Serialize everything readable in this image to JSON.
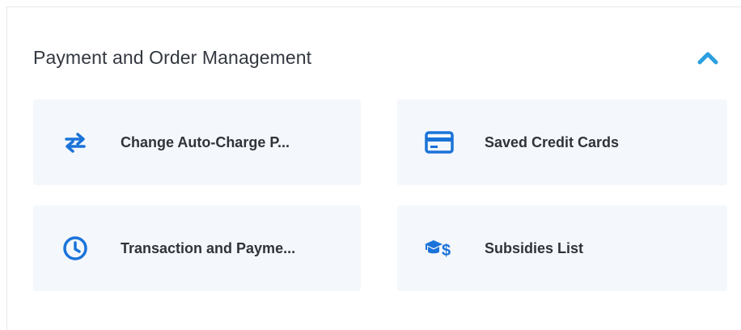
{
  "section": {
    "title": "Payment and Order Management"
  },
  "cards": [
    {
      "label": "Change Auto-Charge P...",
      "icon": "swap-arrows-icon"
    },
    {
      "label": "Saved Credit Cards",
      "icon": "credit-card-icon"
    },
    {
      "label": "Transaction and Payme...",
      "icon": "clock-icon"
    },
    {
      "label": "Subsidies List",
      "icon": "graduation-cap-dollar-icon"
    }
  ],
  "colors": {
    "accent": "#1a73d9",
    "card_bg": "#f4f7fb",
    "text": "#2f343b",
    "chevron": "#2b9fe0"
  }
}
